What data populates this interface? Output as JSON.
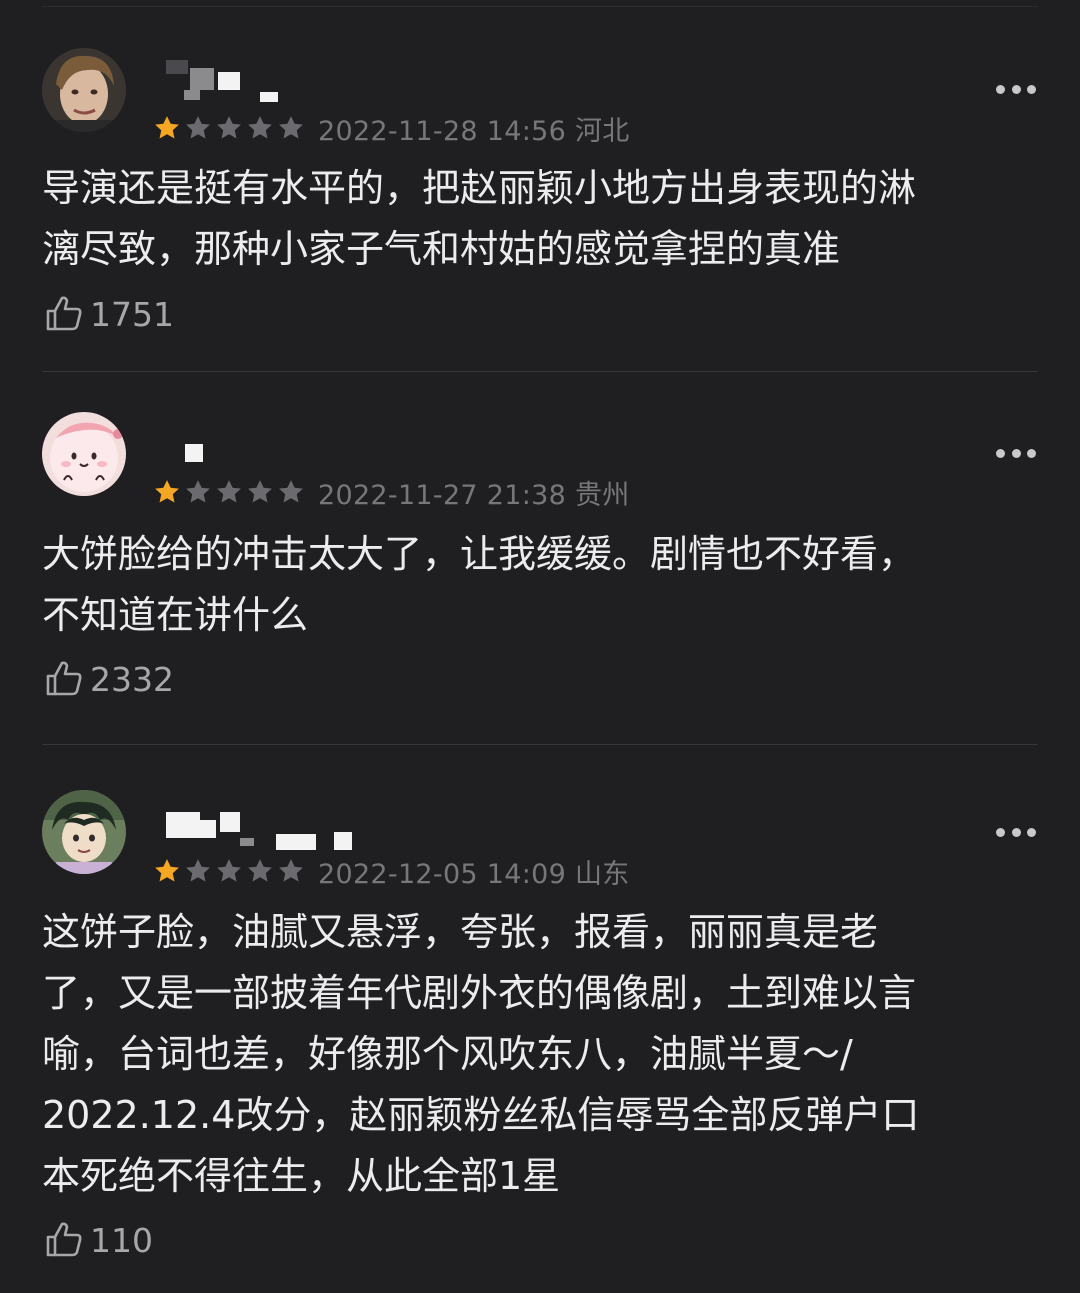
{
  "reviews": [
    {
      "date": "2022-11-28 14:56",
      "location": "河北",
      "rating": 1,
      "max_rating": 5,
      "content_lines": [
        "导演还是挺有水平的，把赵丽颖小地方出身表现的淋",
        "漓尽致，那种小家子气和村姑的感觉拿捏的真准"
      ],
      "likes": "1751"
    },
    {
      "date": "2022-11-27 21:38",
      "location": "贵州",
      "rating": 1,
      "max_rating": 5,
      "content_lines": [
        "大饼脸给的冲击太大了，让我缓缓。剧情也不好看，",
        "不知道在讲什么"
      ],
      "likes": "2332"
    },
    {
      "date": "2022-12-05 14:09",
      "location": "山东",
      "rating": 1,
      "max_rating": 5,
      "content_lines": [
        "这饼子脸，油腻又悬浮，夸张，报看，丽丽真是老",
        "了，又是一部披着年代剧外衣的偶像剧，土到难以言",
        "喻，台词也差，好像那个风吹东八，油腻半夏～/",
        "2022.12.4改分，赵丽颖粉丝私信辱骂全部反弹户口",
        "本死绝不得往生，从此全部1星"
      ],
      "likes": "110"
    }
  ],
  "colors": {
    "background": "#1f1f22",
    "star_filled": "#f5a623",
    "star_empty": "#6b6b6f",
    "meta_text": "#77777b"
  },
  "icons": {
    "more": "more-icon",
    "like": "thumbs-up-icon",
    "star": "star-icon"
  }
}
